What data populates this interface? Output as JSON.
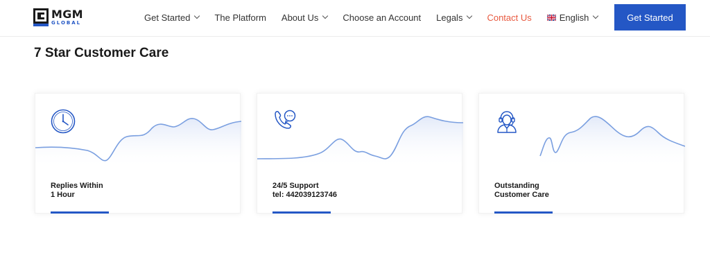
{
  "logo": {
    "main": "MGM",
    "sub": "GLOBAL"
  },
  "nav": [
    {
      "label": "Get Started",
      "has_dropdown": true
    },
    {
      "label": "The Platform",
      "has_dropdown": false
    },
    {
      "label": "About Us",
      "has_dropdown": true
    },
    {
      "label": "Choose an Account",
      "has_dropdown": false
    },
    {
      "label": "Legals",
      "has_dropdown": true
    },
    {
      "label": "Contact Us",
      "has_dropdown": false,
      "active": true
    },
    {
      "label": "English",
      "has_dropdown": true,
      "icon": "uk-flag-icon"
    }
  ],
  "cta_label": "Get Started",
  "page_title": "7 Star Customer Care",
  "cards": [
    {
      "icon": "clock-icon",
      "line1": "Replies Within",
      "line2": "1 Hour"
    },
    {
      "icon": "phone-chat-icon",
      "line1": "24/5 Support",
      "line2": "tel: 442039123746"
    },
    {
      "icon": "support-agent-icon",
      "line1": "Outstanding",
      "line2": "Customer Care"
    }
  ],
  "colors": {
    "brand": "#2457c5",
    "active_nav": "#e8593f",
    "wave_line": "#7a9fe0"
  }
}
